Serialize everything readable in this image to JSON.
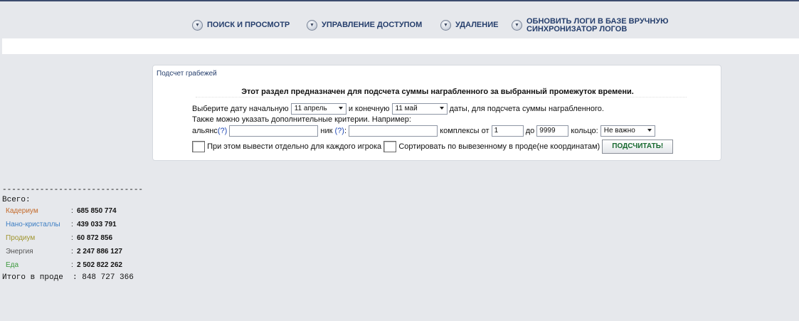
{
  "nav": {
    "items": [
      {
        "label": "ПОИСК И ПРОСМОТР"
      },
      {
        "label": "УПРАВЛЕНИЕ ДОСТУПОМ"
      },
      {
        "label": "УДАЛЕНИЕ"
      },
      {
        "label_line1": "ОБНОВИТЬ ЛОГИ В БАЗЕ ВРУЧНУЮ",
        "label_line2": "СИНХРОНИЗАТОР ЛОГОВ"
      }
    ],
    "icon": "chevron-down-circle-icon",
    "icon_glyph": "▼"
  },
  "panel": {
    "title": "Подсчет грабежей",
    "heading": "Этот раздел предназначен для подсчета суммы награбленного за выбранный промежуток времени.",
    "date_prefix": "Выберите дату начальную",
    "date_start": "11 апрель",
    "date_middle": "и конечную",
    "date_end": "11 май",
    "date_suffix": "даты, для подсчета суммы награбленного.",
    "extra_note": "Также можно указать дополнительные критерии. Например:",
    "alliance_label": "альянс",
    "help_mark": "(?)",
    "nick_label": "ник",
    "nick_colon": ":",
    "alliance_colon": "",
    "alliance_value": "",
    "nick_value": "",
    "complexes_label": "комплексы от",
    "complexes_from": "1",
    "complexes_to_label": "до",
    "complexes_to": "9999",
    "ring_label": "кольцо:",
    "ring_value": "Не важно",
    "check_each_player": "При этом вывести отдельно для каждого игрока",
    "check_sort": "Сортировать по вывезенному в проде(не координатам)",
    "submit_label": "ПОДСЧИТАТЬ!"
  },
  "results": {
    "separator": "------------------------------",
    "total_label": "Всего:",
    "items": [
      {
        "name": "Кадериум",
        "value": "685 850 774",
        "color": "#c46a2a"
      },
      {
        "name": "Нано-кристаллы",
        "value": "439 033 791",
        "color": "#3e7fc4"
      },
      {
        "name": "Продиум",
        "value": "60 872 856",
        "color": "#a0952f"
      },
      {
        "name": "Энергия",
        "value": "2 247 886 127",
        "color": "#555555"
      },
      {
        "name": "Еда",
        "value": "2 502 822 262",
        "color": "#3e9a3e"
      }
    ],
    "colon": ":",
    "prod_total": "Итого в проде  : 848 727 366"
  },
  "colors": {
    "background": "#e6e8ec",
    "nav_text": "#253e6c",
    "link": "#2149b6",
    "button_text": "#17692e"
  }
}
